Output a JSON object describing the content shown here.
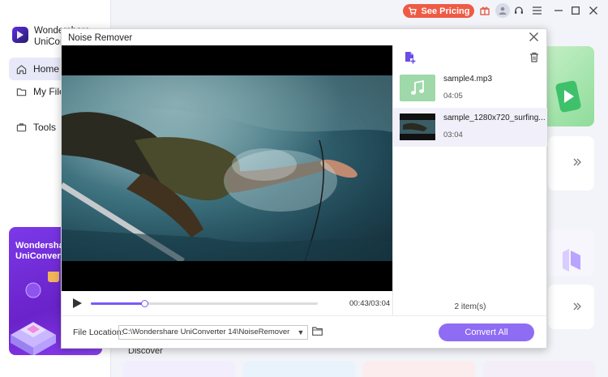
{
  "app": {
    "brand_line1": "Wondershare",
    "brand_line2": "UniConverter",
    "nav": [
      {
        "label": "Home",
        "icon": "home-icon"
      },
      {
        "label": "My Files",
        "icon": "folder-icon"
      },
      {
        "label": "Tools",
        "icon": "tools-icon"
      }
    ],
    "promo_line1": "Wondershare",
    "promo_line2": "UniConverter",
    "see_pricing": "See Pricing",
    "discover": "Discover"
  },
  "dialog": {
    "title": "Noise Remover",
    "player": {
      "current_time": "00:43",
      "total_time": "03:04",
      "time_display": "00:43/03:04",
      "progress_fraction": 0.234
    },
    "files": [
      {
        "name": "sample4.mp3",
        "duration": "04:05",
        "selected": false,
        "kind": "audio"
      },
      {
        "name": "sample_1280x720_surfing...",
        "duration": "03:04",
        "selected": true,
        "kind": "video"
      }
    ],
    "items_count": "2 item(s)",
    "file_location_label": "File Location:",
    "file_location_value": "C:\\Wondershare UniConverter 14\\NoiseRemover",
    "convert_all": "Convert All"
  },
  "colors": {
    "accent": "#8f6cf4",
    "pricing": "#ee5b45",
    "audio_thumb": "#9fd8a9"
  }
}
